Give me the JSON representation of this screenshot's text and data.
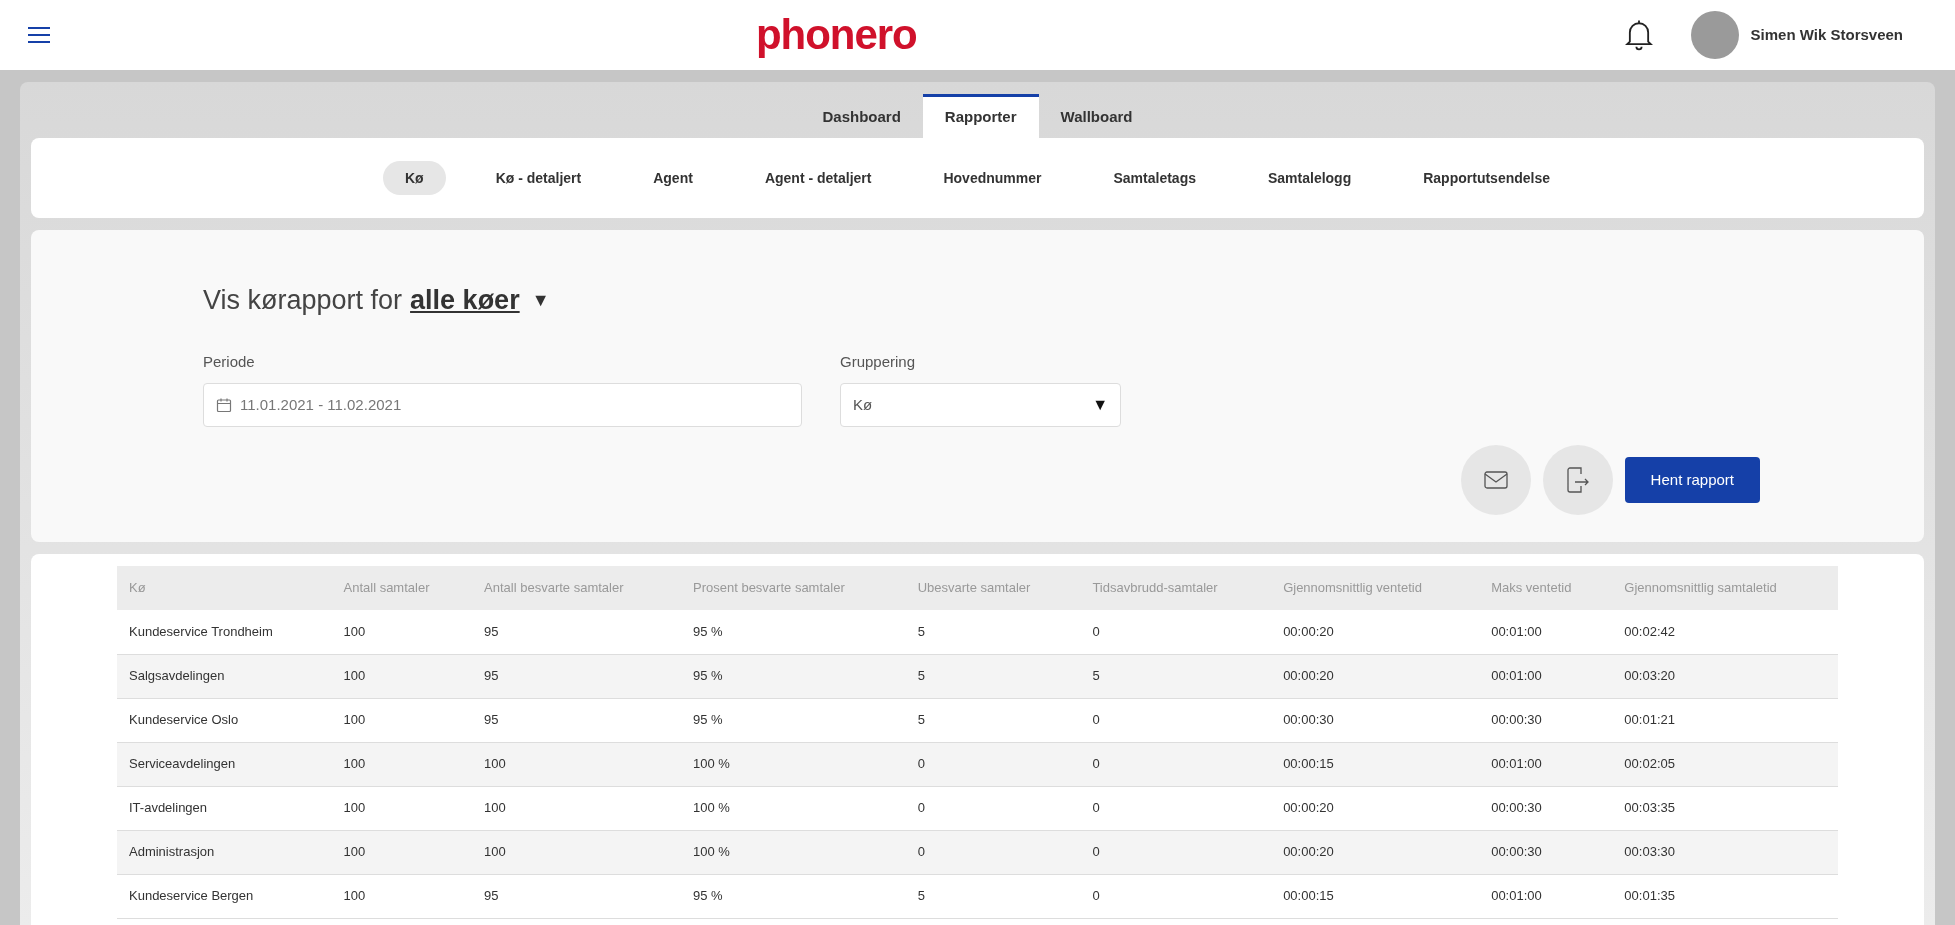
{
  "header": {
    "logo": "phonero",
    "user_name": "Simen Wik Storsveen"
  },
  "main_tabs": [
    {
      "label": "Dashboard",
      "selected": false
    },
    {
      "label": "Rapporter",
      "selected": true
    },
    {
      "label": "Wallboard",
      "selected": false
    }
  ],
  "sub_tabs": [
    {
      "label": "Kø",
      "selected": true
    },
    {
      "label": "Kø - detaljert",
      "selected": false
    },
    {
      "label": "Agent",
      "selected": false
    },
    {
      "label": "Agent - detaljert",
      "selected": false
    },
    {
      "label": "Hovednummer",
      "selected": false
    },
    {
      "label": "Samtaletags",
      "selected": false
    },
    {
      "label": "Samtalelogg",
      "selected": false
    },
    {
      "label": "Rapportutsendelse",
      "selected": false
    }
  ],
  "report": {
    "title_prefix": "Vis kørapport for",
    "title_link": "alle køer",
    "caret": "▼",
    "period": {
      "label": "Periode",
      "value": "11.01.2021 - 11.02.2021"
    },
    "grouping": {
      "label": "Gruppering",
      "value": "Kø",
      "caret": "▼"
    },
    "submit": "Hent rapport"
  },
  "table": {
    "columns": [
      "Kø",
      "Antall samtaler",
      "Antall besvarte samtaler",
      "Prosent besvarte samtaler",
      "Ubesvarte samtaler",
      "Tidsavbrudd-samtaler",
      "Gjennomsnittlig ventetid",
      "Maks ventetid",
      "Gjennomsnittlig samtaletid"
    ],
    "rows": [
      [
        "Kundeservice Trondheim",
        "100",
        "95",
        "95 %",
        "5",
        "0",
        "00:00:20",
        "00:01:00",
        "00:02:42"
      ],
      [
        "Salgsavdelingen",
        "100",
        "95",
        "95 %",
        "5",
        "5",
        "00:00:20",
        "00:01:00",
        "00:03:20"
      ],
      [
        "Kundeservice Oslo",
        "100",
        "95",
        "95 %",
        "5",
        "0",
        "00:00:30",
        "00:00:30",
        "00:01:21"
      ],
      [
        "Serviceavdelingen",
        "100",
        "100",
        "100 %",
        "0",
        "0",
        "00:00:15",
        "00:01:00",
        "00:02:05"
      ],
      [
        "IT-avdelingen",
        "100",
        "100",
        "100 %",
        "0",
        "0",
        "00:00:20",
        "00:00:30",
        "00:03:35"
      ],
      [
        "Administrasjon",
        "100",
        "100",
        "100 %",
        "0",
        "0",
        "00:00:20",
        "00:00:30",
        "00:03:30"
      ],
      [
        "Kundeservice Bergen",
        "100",
        "95",
        "95 %",
        "5",
        "0",
        "00:00:15",
        "00:01:00",
        "00:01:35"
      ]
    ]
  }
}
